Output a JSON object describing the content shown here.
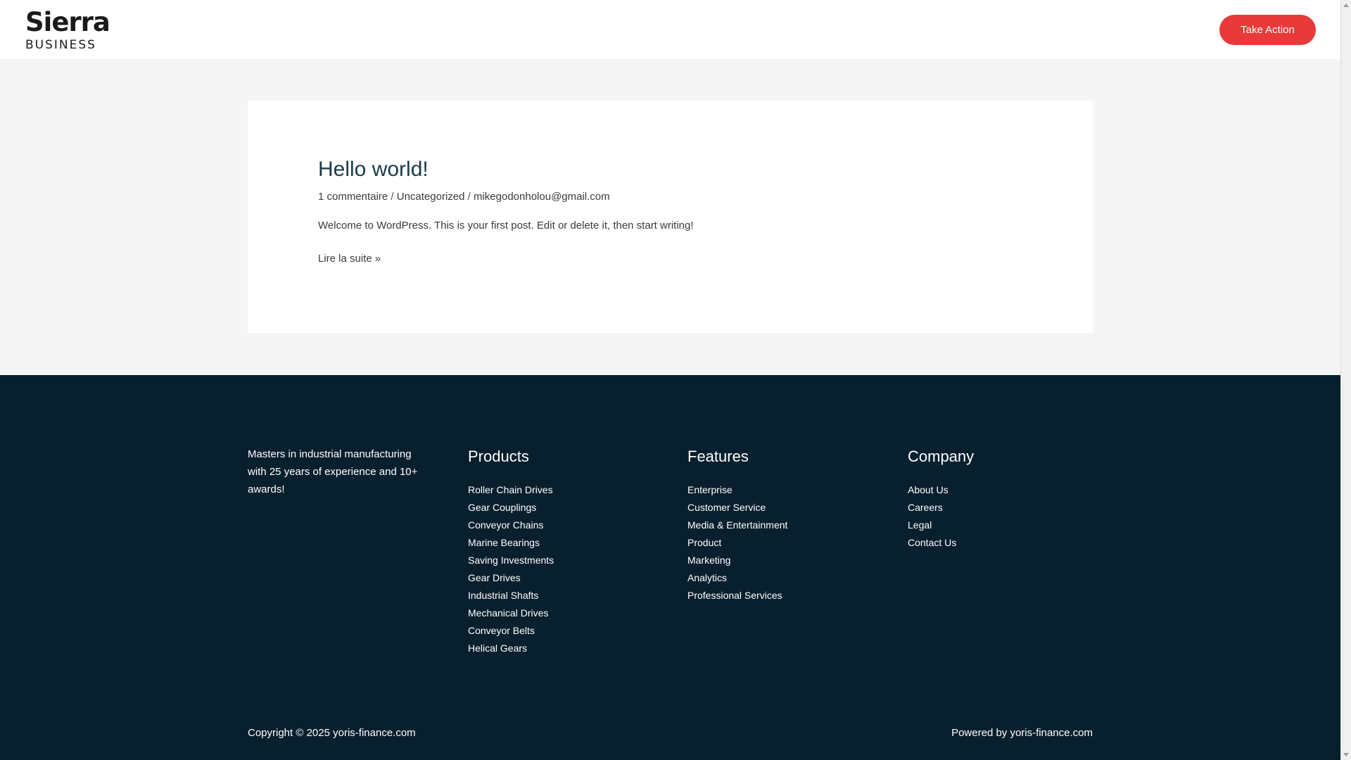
{
  "header": {
    "logo_top": "Sierra",
    "logo_bottom": "BUSINESS",
    "cta_label": "Take Action"
  },
  "post": {
    "title": "Hello world!",
    "meta_comments": "1 commentaire",
    "meta_sep1": " / ",
    "meta_category": "Uncategorized",
    "meta_sep2": " / ",
    "meta_author": "mikegodonholou@gmail.com",
    "excerpt": "Welcome to WordPress. This is your first post. Edit or delete it, then start writing!",
    "read_more": "Lire la suite »"
  },
  "footer": {
    "about": "Masters in industrial manufacturing with 25 years of experience and 10+ awards!",
    "products": {
      "heading": "Products",
      "items": [
        "Roller Chain Drives",
        "Gear Couplings",
        "Conveyor Chains",
        "Marine Bearings",
        "Saving Investments",
        "Gear Drives",
        "Industrial Shafts",
        "Mechanical Drives",
        "Conveyor Belts",
        "Helical Gears"
      ]
    },
    "features": {
      "heading": "Features",
      "items": [
        "Enterprise",
        "Customer Service",
        "Media & Entertainment",
        "Product",
        "Marketing",
        "Analytics",
        "Professional Services"
      ]
    },
    "company": {
      "heading": "Company",
      "items": [
        "About Us",
        "Careers",
        "Legal",
        "Contact Us"
      ]
    },
    "copyright": "Copyright © 2025 yoris-finance.com",
    "powered": "Powered by yoris-finance.com"
  },
  "colors": {
    "accent": "#e83a3a",
    "footer_bg": "#081f2e",
    "page_bg": "#f5f5f5"
  }
}
